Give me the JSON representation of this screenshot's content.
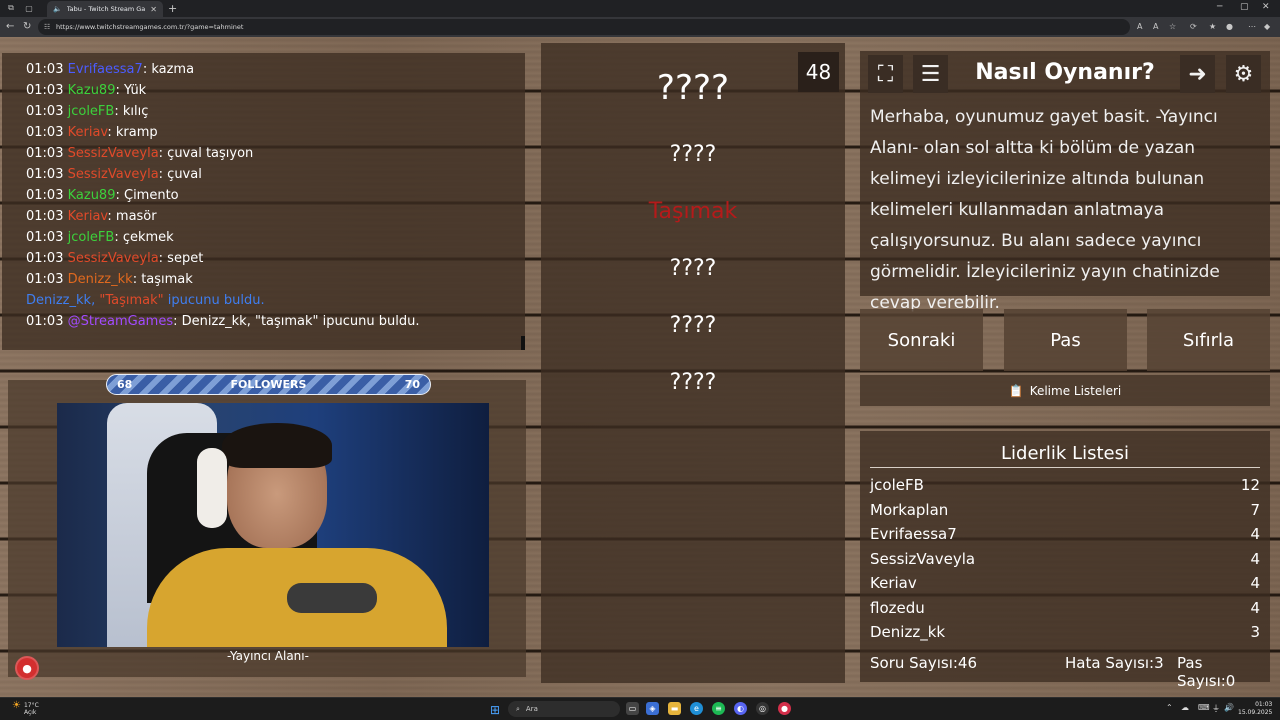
{
  "browser": {
    "tab_title": "Tabu - Twitch Stream Games",
    "url": "https://www.twitchstreamgames.com.tr/?game=tahminet"
  },
  "chat": {
    "messages": [
      {
        "time": "01:03",
        "user": "Evrifaessa7",
        "user_color": "#4b5cff",
        "text": ": kazma"
      },
      {
        "time": "01:03",
        "user": "Kazu89",
        "user_color": "#3cd13c",
        "text": ": Yük"
      },
      {
        "time": "01:03",
        "user": "jcoleFB",
        "user_color": "#3cd13c",
        "text": ": kılıç"
      },
      {
        "time": "01:03",
        "user": "Keriav",
        "user_color": "#e04a2a",
        "text": ": kramp"
      },
      {
        "time": "01:03",
        "user": "SessizVaveyla",
        "user_color": "#e04a2a",
        "text": ": çuval taşıyon"
      },
      {
        "time": "01:03",
        "user": "SessizVaveyla",
        "user_color": "#e04a2a",
        "text": ": çuval"
      },
      {
        "time": "01:03",
        "user": "Kazu89",
        "user_color": "#3cd13c",
        "text": ": Çimento"
      },
      {
        "time": "01:03",
        "user": "Keriav",
        "user_color": "#e04a2a",
        "text": ": masör"
      },
      {
        "time": "01:03",
        "user": "jcoleFB",
        "user_color": "#3cd13c",
        "text": ": çekmek"
      },
      {
        "time": "01:03",
        "user": "SessizVaveyla",
        "user_color": "#e04a2a",
        "text": ": sepet"
      },
      {
        "time": "01:03",
        "user": "Denizz_kk",
        "user_color": "#e0691f",
        "text": ": taşımak"
      }
    ],
    "system_line": {
      "user": "Denizz_kk,",
      "word": "\"Taşımak\"",
      "text": "ipucunu buldu."
    },
    "bot_line": {
      "time": "01:03",
      "user": "@StreamGames",
      "text": ": Denizz_kk, \"taşımak\" ipucunu buldu."
    }
  },
  "stream": {
    "followers_label": "FOLLOWERS",
    "followers_current": "68",
    "followers_goal": "70",
    "caption": "-Yayıncı Alanı-"
  },
  "game": {
    "timer": "48",
    "words": [
      "????",
      "????",
      "Taşımak",
      "????",
      "????",
      "????"
    ]
  },
  "howto": {
    "title": "Nasıl Oynanır?",
    "body": "Merhaba, oyunumuz gayet basit. -Yayıncı Alanı- olan sol altta ki bölüm de yazan kelimeyi izleyicilerinize altında bulunan kelimeleri kullanmadan anlatmaya çalışıyorsunuz. Bu alanı sadece yayıncı görmelidir. İzleyicileriniz yayın chatinizde cevap verebilir."
  },
  "controls": {
    "next": "Sonraki",
    "pass": "Pas",
    "reset": "Sıfırla",
    "word_lists": "Kelime Listeleri"
  },
  "leaderboard": {
    "title": "Liderlik Listesi",
    "rows": [
      {
        "name": "jcoleFB",
        "score": "12"
      },
      {
        "name": "Morkaplan",
        "score": "7"
      },
      {
        "name": "Evrifaessa7",
        "score": "4"
      },
      {
        "name": "SessizVaveyla",
        "score": "4"
      },
      {
        "name": "Keriav",
        "score": "4"
      },
      {
        "name": "flozedu",
        "score": "4"
      },
      {
        "name": "Denizz_kk",
        "score": "3"
      }
    ],
    "question_count": "Soru Sayısı:46",
    "error_count": "Hata Sayısı:3",
    "pass_count": "Pas Sayısı:0"
  },
  "taskbar": {
    "weather_temp": "17°C",
    "weather_desc": "Açık",
    "search_placeholder": "Ara",
    "time": "01:03",
    "date": "15.09.2025"
  }
}
